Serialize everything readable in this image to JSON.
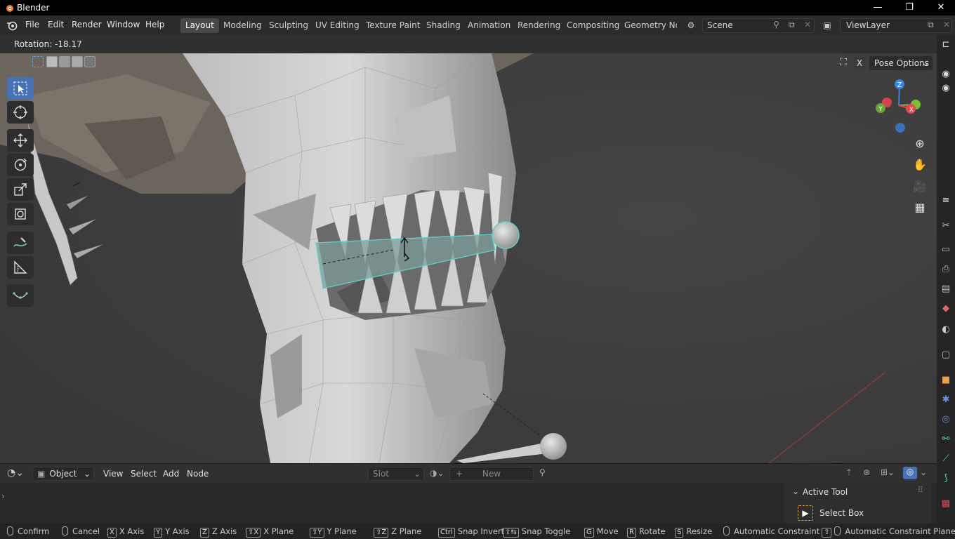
{
  "window": {
    "title": "Blender",
    "controls": {
      "minimize": "—",
      "maximize": "❐",
      "close": "✕"
    }
  },
  "menu": {
    "items": [
      "File",
      "Edit",
      "Render",
      "Window",
      "Help"
    ]
  },
  "workspaces": {
    "tabs": [
      "Layout",
      "Modeling",
      "Sculpting",
      "UV Editing",
      "Texture Paint",
      "Shading",
      "Animation",
      "Rendering",
      "Compositing",
      "Geometry Noc"
    ],
    "active": "Layout"
  },
  "scene": {
    "label": "Scene"
  },
  "view_layer": {
    "label": "ViewLayer"
  },
  "viewport_header": {
    "operator_status": "Rotation: -18.17",
    "pose_options": "Pose Options",
    "overlay_x": "X"
  },
  "toolbar": {
    "tools": [
      "select-box",
      "cursor",
      "move",
      "rotate",
      "scale",
      "transform",
      "annotate",
      "measure",
      "bone-roll"
    ],
    "active": "select-box"
  },
  "gizmo": {
    "axes": {
      "z": "Z",
      "y": "Y",
      "x": "X"
    },
    "colors": {
      "x": "#e0474f",
      "y": "#7bbf38",
      "z": "#3b84d9"
    }
  },
  "shader_header": {
    "editor_type": "Object",
    "menus": [
      "View",
      "Select",
      "Add",
      "Node"
    ],
    "slot": "Slot",
    "new_label": "New"
  },
  "active_tool": {
    "title": "Active Tool",
    "tool_name": "Select Box"
  },
  "status_bar": {
    "items": [
      {
        "key": "mouse",
        "label": "Confirm"
      },
      {
        "key": "mouse",
        "label": "Cancel"
      },
      {
        "key": "X",
        "label": "X Axis"
      },
      {
        "key": "Y",
        "label": "Y Axis"
      },
      {
        "key": "Z",
        "label": "Z Axis"
      },
      {
        "key": "⇧X",
        "label": "X Plane"
      },
      {
        "key": "⇧Y",
        "label": "Y Plane"
      },
      {
        "key": "⇧Z",
        "label": "Z Plane"
      },
      {
        "key": "Ctrl",
        "label": "Snap Invert"
      },
      {
        "key": "⇧⇆",
        "label": "Snap Toggle"
      },
      {
        "key": "G",
        "label": "Move"
      },
      {
        "key": "R",
        "label": "Rotate"
      },
      {
        "key": "S",
        "label": "Resize"
      },
      {
        "key": "mouse",
        "label": "Automatic Constraint"
      },
      {
        "key": "⇧mouse",
        "label": "Automatic Constraint Plane"
      }
    ]
  },
  "colors": {
    "accent": "#4772b3",
    "selection_outline": "#5fd0c9"
  }
}
